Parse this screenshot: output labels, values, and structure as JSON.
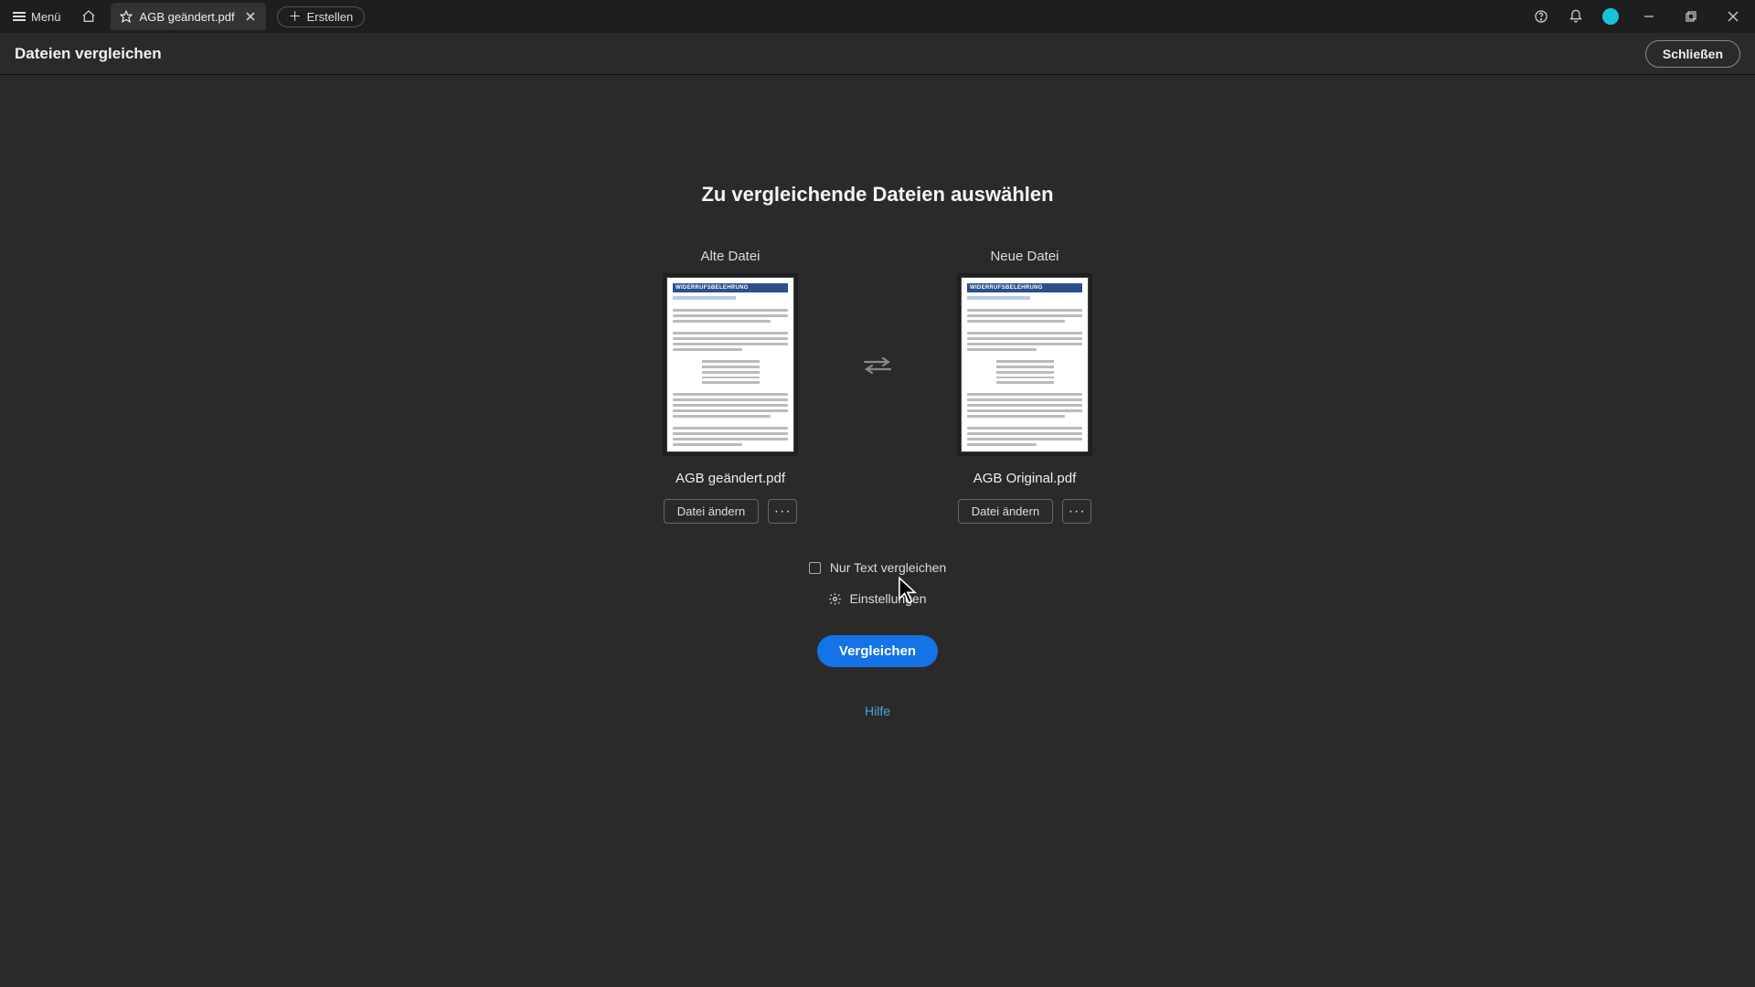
{
  "titlebar": {
    "menu_label": "Menü",
    "tab_title": "AGB geändert.pdf",
    "create_label": "Erstellen"
  },
  "tool_header": {
    "title": "Dateien vergleichen",
    "close_label": "Schließen"
  },
  "headline": "Zu vergleichende Dateien auswählen",
  "old_file": {
    "label": "Alte Datei",
    "name": "AGB geändert.pdf",
    "change_label": "Datei ändern",
    "thumb_title": "WIDERRUFSBELEHRUNG"
  },
  "new_file": {
    "label": "Neue Datei",
    "name": "AGB Original.pdf",
    "change_label": "Datei ändern",
    "thumb_title": "WIDERRUFSBELEHRUNG"
  },
  "options": {
    "text_only_label": "Nur Text vergleichen",
    "settings_label": "Einstellungen",
    "compare_label": "Vergleichen"
  },
  "help_label": "Hilfe"
}
